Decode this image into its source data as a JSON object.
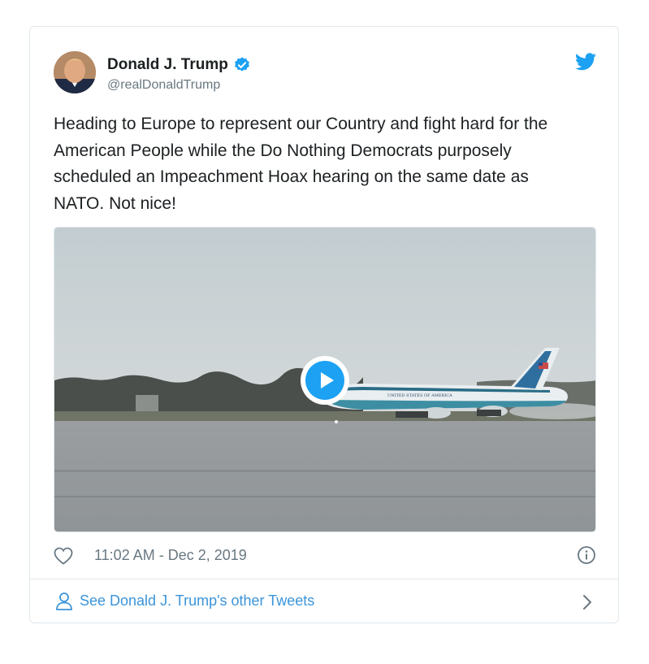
{
  "tweet": {
    "author_name": "Donald J. Trump",
    "author_handle": "@realDonaldTrump",
    "text": "Heading to Europe to represent our Country and fight hard for the\nAmerican People while the Do Nothing Democrats purposely\nscheduled an Impeachment Hoax hearing on the same date as\nNATO. Not nice!",
    "timestamp": "11:02 AM - Dec 2, 2019",
    "media_caption": "UNITED STATES OF AMERICA"
  },
  "footer": {
    "link_label": "See Donald J. Trump's other Tweets"
  },
  "icons": {
    "verified": "verified-badge-icon",
    "bird": "twitter-bird-icon",
    "play": "play-icon",
    "like": "heart-icon",
    "info": "info-icon",
    "profile": "person-icon",
    "chevron": "chevron-right-icon"
  },
  "colors": {
    "brand_blue": "#1da1f2",
    "link_blue": "#3b94d9",
    "text_primary": "#1c2022",
    "text_secondary": "#697882",
    "border": "#e1e8ed"
  }
}
